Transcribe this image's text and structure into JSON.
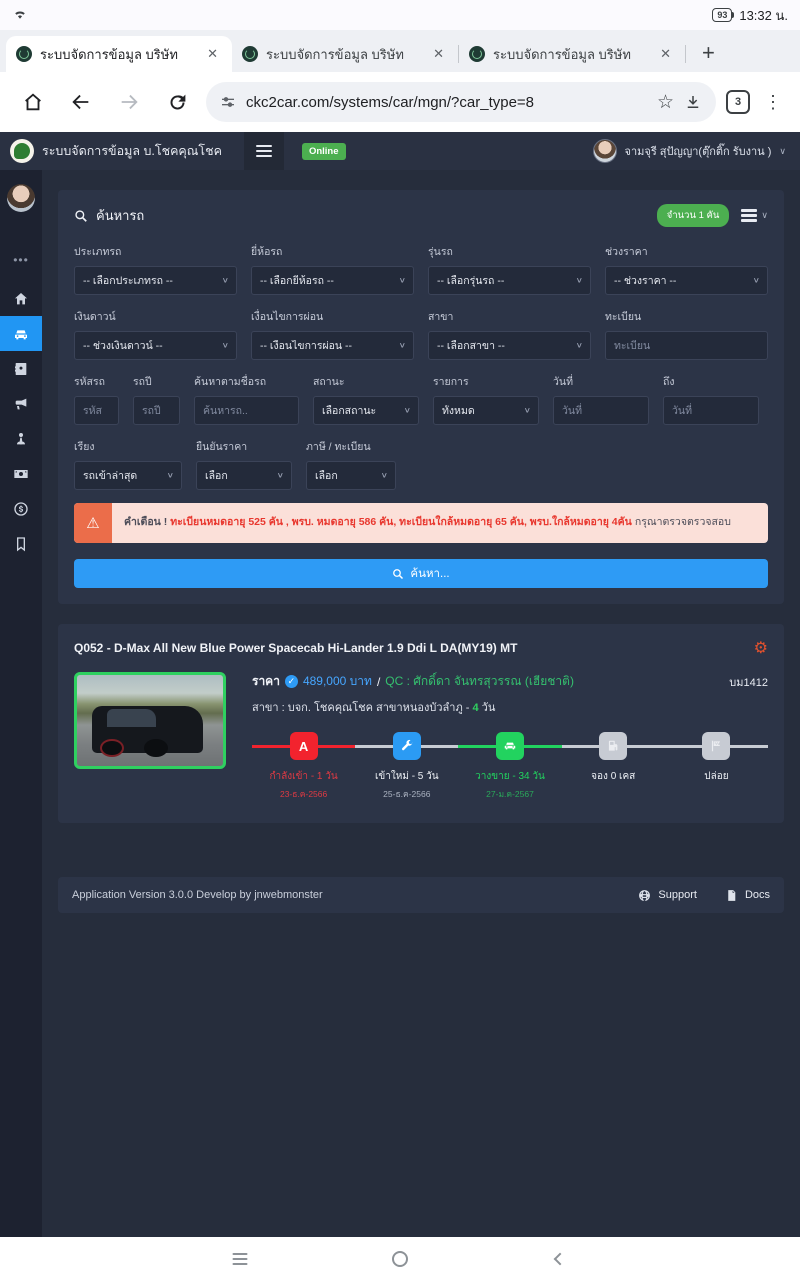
{
  "status_bar": {
    "time": "13:32 น.",
    "battery_percent": "93"
  },
  "browser": {
    "tabs": [
      {
        "title": "ระบบจัดการข้อมูล บริษัท",
        "close": "✕"
      },
      {
        "title": "ระบบจัดการข้อมูล บริษัท",
        "close": "✕"
      },
      {
        "title": "ระบบจัดการข้อมูล บริษัท",
        "close": "✕"
      }
    ],
    "new_tab": "+",
    "url": "ckc2car.com/systems/car/mgn/?car_type=8",
    "bookmark_star": "☆",
    "tab_count": "3",
    "menu": "⋮"
  },
  "header": {
    "app_title": "ระบบจัดการข้อมูล บ.โชคคุณโชค",
    "online": "Online",
    "user": "จามจุรี สุปัญญา(ตุ๊กติ๊ก รับงาน )",
    "caret": "∨"
  },
  "sidebar": {
    "dots": "•••"
  },
  "search": {
    "title": "ค้นหารถ",
    "count_badge": "จำนวน 1 คัน",
    "fields": {
      "car_type": {
        "label": "ประเภทรถ",
        "value": "-- เลือกประเภทรถ --"
      },
      "brand": {
        "label": "ยี่ห้อรถ",
        "value": "-- เลือกยี่ห้อรถ --"
      },
      "model": {
        "label": "รุ่นรถ",
        "value": "-- เลือกรุ่นรถ --"
      },
      "price_range": {
        "label": "ช่วงราคา",
        "value": "-- ช่วงราคา --"
      },
      "down": {
        "label": "เงินดาวน์",
        "value": "-- ช่วงเงินดาวน์ --"
      },
      "installment": {
        "label": "เงื่อนไขการผ่อน",
        "value": "-- เงื่อนไขการผ่อน --"
      },
      "branch": {
        "label": "สาขา",
        "value": "-- เลือกสาขา --"
      },
      "plate": {
        "label": "ทะเบียน",
        "placeholder": "ทะเบียน"
      },
      "code": {
        "label": "รหัสรถ",
        "placeholder": "รหัส"
      },
      "year": {
        "label": "รถปี",
        "placeholder": "รถปี"
      },
      "name": {
        "label": "ค้นหาตามชื่อรถ",
        "placeholder": "ค้นหารถ.."
      },
      "status": {
        "label": "สถานะ",
        "value": "เลือกสถานะ"
      },
      "list": {
        "label": "รายการ",
        "value": "ทั้งหมด"
      },
      "date_from": {
        "label": "วันที่",
        "placeholder": "วันที่"
      },
      "date_to": {
        "label": "ถึง",
        "placeholder": "วันที่"
      },
      "sort": {
        "label": "เรียง",
        "value": "รถเข้าล่าสุด"
      },
      "confirm": {
        "label": "ยืนยันราคา",
        "value": "เลือก"
      },
      "tax": {
        "label": "ภาษี / ทะเบียน",
        "value": "เลือก"
      }
    },
    "warning": {
      "icon": "⚠",
      "prefix": "คำเตือน !",
      "highlight": "ทะเบียนหมดอายุ 525 คัน , พรบ. หมดอายุ 586 คัน, ทะเบียนใกล้หมดอายุ 65 คัน, พรบ.ใกล้หมดอายุ 4คัน",
      "suffix": "กรุณาตรวจตรวจสอบ"
    },
    "submit": "ค้นหา..."
  },
  "car": {
    "title": "Q052 - D-Max All New Blue Power Spacecab Hi-Lander 1.9 Ddi L DA(MY19) MT",
    "price_label": "ราคา",
    "verified_check": "✓",
    "price": "489,000 บาท",
    "separator": "/",
    "qc": "QC : ศักดิ์ดา  จันทรสุวรรณ (เฮียชาติ)",
    "ref": "บม1412",
    "branch_prefix": "สาขา : บจก. โชคคุณโชค สาขาหนองบัวลำภู -",
    "days": "4",
    "days_unit": "วัน",
    "stage1_glyph": "A",
    "timeline": [
      {
        "label": "กำลังเข้า - 1 วัน",
        "date": "23-ธ.ค-2566"
      },
      {
        "label": "เข้าใหม่ - 5 วัน",
        "date": "25-ธ.ค-2566"
      },
      {
        "label": "วางขาย - 34 วัน",
        "date": "27-ม.ค-2567"
      },
      {
        "label": "จอง 0 เคส",
        "date": ""
      },
      {
        "label": "ปล่อย",
        "date": ""
      }
    ]
  },
  "footer": {
    "version": "Application Version 3.0.0 Develop by jnwebmonster",
    "support": "Support",
    "docs": "Docs"
  },
  "colors": {
    "accent_blue": "#2e9bf5",
    "badge_green": "#4caf50",
    "timeline_green": "#22d35f",
    "timeline_red": "#f2232e",
    "warning_bg": "#fbe0d9",
    "warning_icon_bg": "#eb6d4a",
    "panel_bg": "#2c3447",
    "page_bg": "#262d3c"
  }
}
